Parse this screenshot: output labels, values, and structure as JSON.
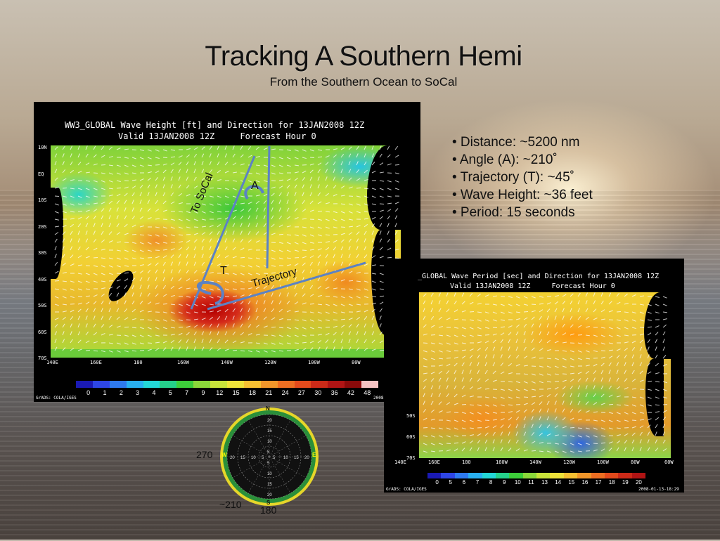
{
  "slide": {
    "title": "Tracking A Southern Hemi",
    "subtitle": "From the Southern Ocean to SoCal"
  },
  "map1": {
    "header_line1": "WW3_GLOBAL Wave Height [ft] and Direction for 13JAN2008 12Z",
    "header_line2": "Valid 13JAN2008 12Z     Forecast Hour 0",
    "lat_labels": [
      "10N",
      "EQ",
      "10S",
      "20S",
      "30S",
      "40S",
      "50S",
      "60S",
      "70S"
    ],
    "lon_labels": [
      "140E",
      "160E",
      "180",
      "160W",
      "140W",
      "120W",
      "100W",
      "80W",
      "60W"
    ],
    "colorbar_labels": [
      "0",
      "1",
      "2",
      "3",
      "4",
      "5",
      "7",
      "9",
      "12",
      "15",
      "18",
      "21",
      "24",
      "27",
      "30",
      "36",
      "42",
      "48"
    ],
    "colorbar_colors": [
      "#1a1ab4",
      "#2e46e6",
      "#2e7af0",
      "#29b0f0",
      "#23d6d6",
      "#25d08a",
      "#3dce3a",
      "#8bd83a",
      "#c8e23a",
      "#eee23a",
      "#f6c032",
      "#f0962a",
      "#ec6e22",
      "#e24a1c",
      "#cc2a18",
      "#b01414",
      "#8a0a0a",
      "#f4c2c2"
    ],
    "footer_left": "GrADS: COLA/IGES",
    "footer_right": "2008-01-13-18:29",
    "annotation_to_socal": "To SoCal",
    "annotation_a": "A",
    "annotation_t": "T",
    "annotation_trajectory": "Trajectory"
  },
  "map2": {
    "header_line1": "_GLOBAL Wave Period [sec] and Direction for 13JAN2008 12Z",
    "header_line2": "Valid 13JAN2008 12Z     Forecast Hour 0",
    "lat_labels": [
      "50S",
      "60S",
      "70S"
    ],
    "lon_labels": [
      "140E",
      "160E",
      "180",
      "160W",
      "140W",
      "120W",
      "100W",
      "80W",
      "60W"
    ],
    "colorbar_labels": [
      "0",
      "5",
      "6",
      "7",
      "8",
      "9",
      "10",
      "11",
      "13",
      "14",
      "15",
      "16",
      "17",
      "18",
      "19",
      "20"
    ],
    "colorbar_colors": [
      "#1a1ab4",
      "#2e46e6",
      "#2e7af0",
      "#29b0f0",
      "#23d6d6",
      "#25d08a",
      "#3dce3a",
      "#8bd83a",
      "#c8e23a",
      "#eee23a",
      "#f6c032",
      "#f0962a",
      "#ec6e22",
      "#e24a1c",
      "#cc2a18",
      "#b01414"
    ],
    "footer_left": "GrADS: COLA/IGES",
    "footer_right": "2008-01-13-18:29"
  },
  "bullets": [
    "• Distance:  ~5200 nm",
    "• Angle (A): ~210˚",
    "• Trajectory (T): ~45˚",
    "• Wave Height: ~36 feet",
    "• Period: 15 seconds"
  ],
  "compass": {
    "north": "N",
    "south": "S",
    "east": "E",
    "west": "W",
    "ring_labels": [
      "5",
      "10",
      "15",
      "20"
    ],
    "label_270": "270",
    "label_210": "~210",
    "label_180": "180",
    "ring_color": "#2a8f3a",
    "rim_color": "#e6d62a"
  }
}
